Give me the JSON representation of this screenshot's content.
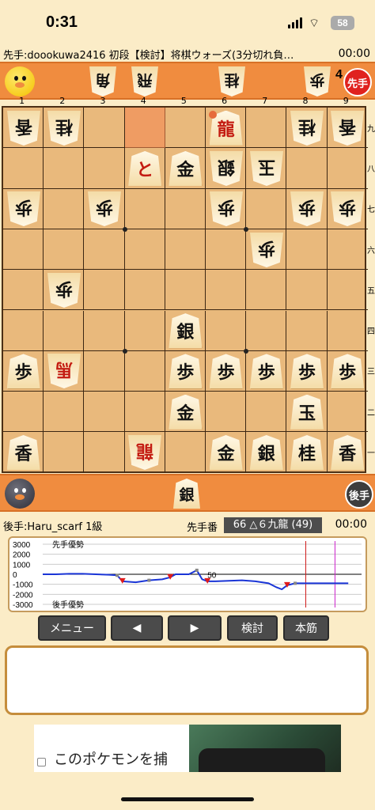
{
  "status_bar": {
    "time": "0:31",
    "battery": "58"
  },
  "header": {
    "sente_label": "先手:doookuwa2416 初段【検討】将棋ウォーズ(3分切れ負…",
    "sente_time": "00:00"
  },
  "gote_hand": {
    "pieces": [
      "角",
      "飛",
      "桂",
      "歩"
    ],
    "pawn_count": "4",
    "badge": "先手"
  },
  "board": {
    "column_labels": [
      "1",
      "2",
      "3",
      "4",
      "5",
      "6",
      "7",
      "8",
      "9"
    ],
    "row_labels": [
      "九",
      "八",
      "七",
      "六",
      "五",
      "四",
      "三",
      "二",
      "一"
    ],
    "pieces": [
      {
        "ch": "香",
        "col": 0,
        "row": 0,
        "side": "gote"
      },
      {
        "ch": "桂",
        "col": 1,
        "row": 0,
        "side": "gote"
      },
      {
        "ch": "龍",
        "col": 5,
        "row": 0,
        "side": "sente",
        "promoted": true
      },
      {
        "ch": "桂",
        "col": 7,
        "row": 0,
        "side": "gote"
      },
      {
        "ch": "香",
        "col": 8,
        "row": 0,
        "side": "gote"
      },
      {
        "ch": "と",
        "col": 3,
        "row": 1,
        "side": "sente",
        "promoted": true
      },
      {
        "ch": "金",
        "col": 4,
        "row": 1,
        "side": "sente"
      },
      {
        "ch": "銀",
        "col": 5,
        "row": 1,
        "side": "gote"
      },
      {
        "ch": "玉",
        "col": 6,
        "row": 1,
        "side": "gote"
      },
      {
        "ch": "歩",
        "col": 0,
        "row": 2,
        "side": "gote"
      },
      {
        "ch": "歩",
        "col": 2,
        "row": 2,
        "side": "gote"
      },
      {
        "ch": "歩",
        "col": 5,
        "row": 2,
        "side": "gote"
      },
      {
        "ch": "歩",
        "col": 7,
        "row": 2,
        "side": "gote"
      },
      {
        "ch": "歩",
        "col": 8,
        "row": 2,
        "side": "gote"
      },
      {
        "ch": "歩",
        "col": 6,
        "row": 3,
        "side": "gote"
      },
      {
        "ch": "歩",
        "col": 1,
        "row": 4,
        "side": "gote"
      },
      {
        "ch": "銀",
        "col": 4,
        "row": 5,
        "side": "sente"
      },
      {
        "ch": "歩",
        "col": 0,
        "row": 6,
        "side": "sente"
      },
      {
        "ch": "馬",
        "col": 1,
        "row": 6,
        "side": "gote",
        "promoted": true
      },
      {
        "ch": "歩",
        "col": 4,
        "row": 6,
        "side": "sente"
      },
      {
        "ch": "歩",
        "col": 5,
        "row": 6,
        "side": "sente"
      },
      {
        "ch": "歩",
        "col": 6,
        "row": 6,
        "side": "sente"
      },
      {
        "ch": "歩",
        "col": 7,
        "row": 6,
        "side": "sente"
      },
      {
        "ch": "歩",
        "col": 8,
        "row": 6,
        "side": "sente"
      },
      {
        "ch": "金",
        "col": 4,
        "row": 7,
        "side": "sente"
      },
      {
        "ch": "玉",
        "col": 7,
        "row": 7,
        "side": "sente"
      },
      {
        "ch": "香",
        "col": 0,
        "row": 8,
        "side": "sente"
      },
      {
        "ch": "龍",
        "col": 3,
        "row": 8,
        "side": "gote",
        "promoted": true
      },
      {
        "ch": "金",
        "col": 5,
        "row": 8,
        "side": "sente"
      },
      {
        "ch": "銀",
        "col": 6,
        "row": 8,
        "side": "sente"
      },
      {
        "ch": "桂",
        "col": 7,
        "row": 8,
        "side": "sente"
      },
      {
        "ch": "香",
        "col": 8,
        "row": 8,
        "side": "sente"
      }
    ],
    "highlight": {
      "col": 3,
      "row": 0
    }
  },
  "sente_hand": {
    "pieces": [
      "銀"
    ],
    "badge": "後手"
  },
  "footer": {
    "gote_label": "後手:Haru_scarf 1級",
    "turn_label": "先手番",
    "move": "66 △６九龍 (49)",
    "gote_time": "00:00"
  },
  "graph": {
    "labels": {
      "top": "先手優勢",
      "bottom": "後手優勢",
      "move_marker": "50"
    },
    "yticks": [
      "3000",
      "2000",
      "1000",
      "0",
      "-1000",
      "-2000",
      "-3000"
    ],
    "line_color": "#1a35d6",
    "chart_data": {
      "type": "line",
      "ylim": [
        -3000,
        3000
      ],
      "x": [
        0,
        5,
        10,
        15,
        20,
        25,
        28,
        30,
        35,
        40,
        45,
        48,
        50,
        55,
        58,
        60,
        62,
        65,
        70,
        75,
        80,
        85,
        88,
        90,
        92,
        95,
        100,
        105,
        110,
        115
      ],
      "values": [
        0,
        0,
        50,
        50,
        0,
        -50,
        -100,
        -700,
        -800,
        -600,
        -500,
        -300,
        0,
        0,
        400,
        -500,
        -700,
        -700,
        -650,
        -600,
        -700,
        -900,
        -1300,
        -1500,
        -1100,
        -900,
        -900,
        -900,
        -900,
        -900
      ]
    },
    "red_marker_move": 99,
    "magenta_marker_move": 110
  },
  "buttons": {
    "menu": "メニュー",
    "prev": "◀",
    "next": "▶",
    "review": "検討",
    "main": "本筋"
  },
  "ad": {
    "text": "このポケモンを捕"
  }
}
